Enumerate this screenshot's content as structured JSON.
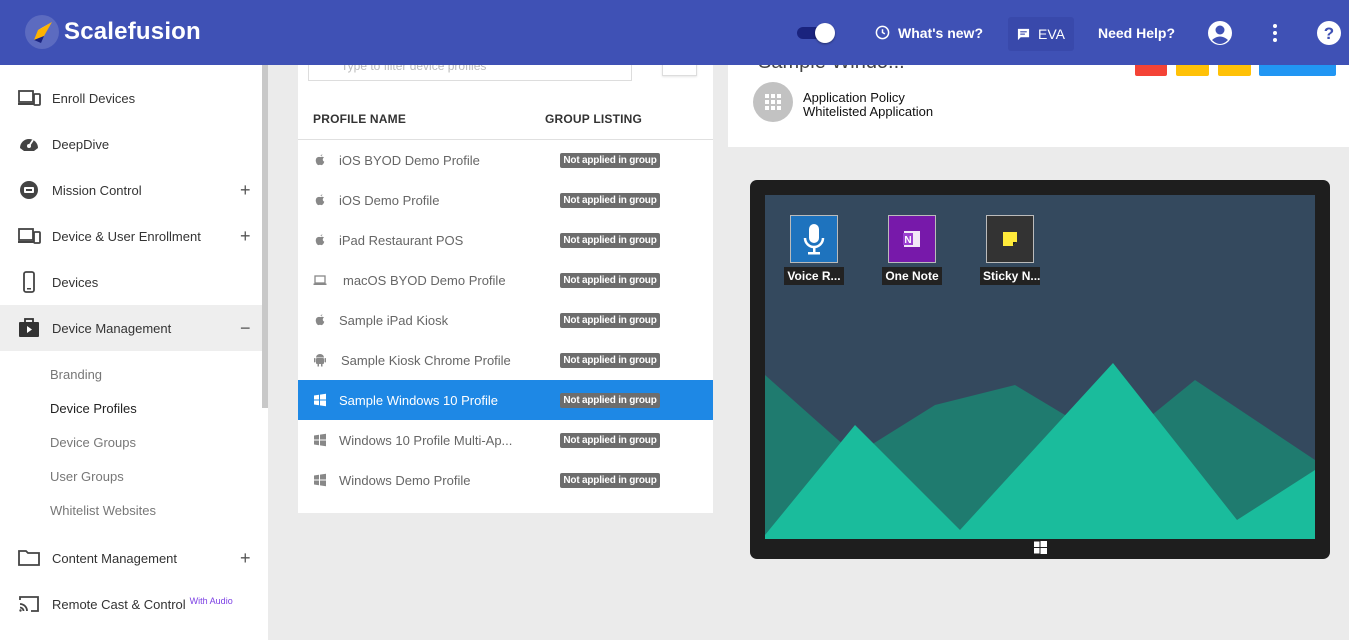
{
  "header": {
    "brand": "Scalefusion",
    "whats_new": "What's new?",
    "eva": "EVA",
    "need_help": "Need Help?"
  },
  "sidebar": {
    "items": [
      {
        "label": "Enroll Devices",
        "icon": "enroll-devices-icon",
        "expandable": false
      },
      {
        "label": "DeepDive",
        "icon": "speedometer-icon",
        "expandable": false
      },
      {
        "label": "Mission Control",
        "icon": "mission-control-icon",
        "expandable": true
      },
      {
        "label": "Device & User Enrollment",
        "icon": "devices-icon",
        "expandable": true
      },
      {
        "label": "Devices",
        "icon": "phone-icon",
        "expandable": false
      },
      {
        "label": "Device Management",
        "icon": "briefcase-icon",
        "expanded": true
      },
      {
        "label": "Content Management",
        "icon": "folder-icon",
        "expandable": true
      },
      {
        "label": "Remote Cast & Control",
        "icon": "cast-icon",
        "tag": "With Audio"
      }
    ],
    "sub_items": [
      "Branding",
      "Device Profiles",
      "Device Groups",
      "User Groups",
      "Whitelist Websites"
    ],
    "selected_sub": "Device Profiles"
  },
  "profiles": {
    "filter_placeholder": "Type to filter device profiles",
    "col_name": "PROFILE NAME",
    "col_group": "GROUP LISTING",
    "rows": [
      {
        "name": "iOS BYOD Demo Profile",
        "os": "apple",
        "group": "Not applied in group"
      },
      {
        "name": "iOS Demo Profile",
        "os": "apple",
        "group": "Not applied in group"
      },
      {
        "name": "iPad Restaurant POS",
        "os": "apple",
        "group": "Not applied in group"
      },
      {
        "name": "macOS BYOD Demo Profile",
        "os": "laptop",
        "group": "Not applied in group"
      },
      {
        "name": "Sample iPad Kiosk",
        "os": "apple",
        "group": "Not applied in group"
      },
      {
        "name": "Sample Kiosk Chrome Profile",
        "os": "android",
        "group": "Not applied in group"
      },
      {
        "name": "Sample Windows 10 Profile",
        "os": "windows",
        "group": "Not applied in group",
        "selected": true
      },
      {
        "name": "Windows 10 Profile Multi-Ap...",
        "os": "windows",
        "group": "Not applied in group"
      },
      {
        "name": "Windows Demo Profile",
        "os": "windows",
        "group": "Not applied in group"
      }
    ]
  },
  "detail": {
    "title": "Sample Windo...",
    "policy_line1": "Application Policy",
    "policy_line2": "Whitelisted Application",
    "apps": [
      {
        "label": "Voice R...",
        "color": "#1e73be",
        "icon": "microphone-icon"
      },
      {
        "label": "One Note",
        "color": "#7719aa",
        "icon": "onenote-icon"
      },
      {
        "label": "Sticky N...",
        "color": "#333333",
        "icon": "sticky-note-icon"
      }
    ]
  },
  "colors": {
    "header": "#3f51b5",
    "selected_row": "#1e88e5",
    "badge": "#6d6d6d",
    "screen_bg": "#34495e",
    "mountain_light": "#1abc9c",
    "mountain_dark": "#1f7b6f"
  }
}
